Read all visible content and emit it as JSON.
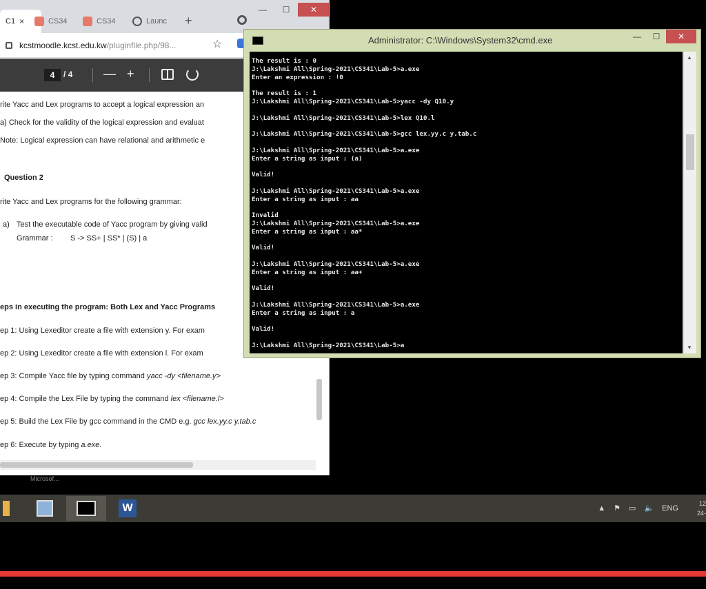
{
  "browser": {
    "tabs": [
      {
        "label": "C1",
        "close": "×"
      },
      {
        "label": "CS34"
      },
      {
        "label": "CS34"
      },
      {
        "label": "Launc"
      }
    ],
    "new_tab": "+",
    "window_buttons": {
      "minimize": "—",
      "maximize": "☐",
      "close": "✕"
    },
    "url_host": "kcstmoodle.kcst.edu.kw",
    "url_path": "/pluginfile.php/98...",
    "pdf": {
      "page_current": "4",
      "page_total": "/ 4",
      "zoom_out": "—",
      "zoom_in": "+"
    },
    "document": {
      "line1": "rite Yacc and Lex programs to accept a logical expression  an",
      "line2": "a) Check for the validity of the logical expression and evaluat",
      "line3": "Note: Logical expression can have relational and arithmetic e",
      "question2": "Question 2",
      "line4": "rite Yacc and Lex programs for the following grammar:",
      "item_a_label": "a)",
      "item_a_text": "Test the executable code of Yacc program by giving valid",
      "grammar_label": "Grammar :",
      "grammar_rule": "S -> SS+ | SS* | (S) | a",
      "steps_heading": "eps in executing the program:  Both Lex and Yacc Programs",
      "step1": "ep 1: Using Lexeditor create a file with extension y. For exam",
      "step2": "ep 2: Using Lexeditor create a file with extension l. For exam",
      "step3_prefix": "ep 3: Compile Yacc file by typing command ",
      "step3_cmd": "yacc -dy <filename.y>",
      "step4_prefix": "ep 4: Compile the Lex File by typing the command ",
      "step4_cmd": "lex <filename.l>",
      "step5_prefix": "ep 5: Build the Lex File by gcc command in the CMD   e.g. ",
      "step5_cmd": "gcc lex.yy.c  y.tab.c",
      "step6_prefix": "ep 6: Execute by typing ",
      "step6_cmd": "a.exe."
    },
    "ghost_label": "Microsof..."
  },
  "cmd": {
    "title": "Administrator: C:\\Windows\\System32\\cmd.exe",
    "window_buttons": {
      "minimize": "—",
      "maximize": "☐",
      "close": "✕"
    },
    "output": "The result is : 0\nJ:\\Lakshmi All\\Spring-2021\\CS341\\Lab-5>a.exe\nEnter an expression : !0\n\nThe result is : 1\nJ:\\Lakshmi All\\Spring-2021\\CS341\\Lab-5>yacc -dy Q10.y\n\nJ:\\Lakshmi All\\Spring-2021\\CS341\\Lab-5>lex Q10.l\n\nJ:\\Lakshmi All\\Spring-2021\\CS341\\Lab-5>gcc lex.yy.c y.tab.c\n\nJ:\\Lakshmi All\\Spring-2021\\CS341\\Lab-5>a.exe\nEnter a string as input : (a)\n\nValid!\n\nJ:\\Lakshmi All\\Spring-2021\\CS341\\Lab-5>a.exe\nEnter a string as input : aa\n\nInvalid\nJ:\\Lakshmi All\\Spring-2021\\CS341\\Lab-5>a.exe\nEnter a string as input : aa*\n\nValid!\n\nJ:\\Lakshmi All\\Spring-2021\\CS341\\Lab-5>a.exe\nEnter a string as input : aa+\n\nValid!\n\nJ:\\Lakshmi All\\Spring-2021\\CS341\\Lab-5>a.exe\nEnter a string as input : a\n\nValid!\n\nJ:\\Lakshmi All\\Spring-2021\\CS341\\Lab-5>a"
  },
  "taskbar": {
    "apps": [
      "folder-icon",
      "picture-icon",
      "cmd-icon",
      "word-icon"
    ],
    "word_letter": "W",
    "tray": {
      "up_arrow": "▲",
      "language": "ENG"
    },
    "clock_time": "12",
    "clock_date": "24-"
  },
  "colors": {
    "cmd_frame": "#d3ddb3",
    "taskbar": "#3c3b35",
    "progress": "#e53935"
  }
}
